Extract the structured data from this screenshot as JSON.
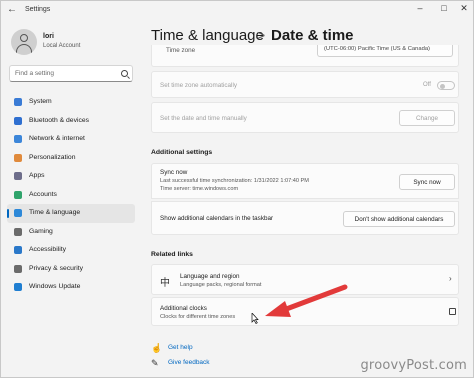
{
  "window": {
    "title": "Settings"
  },
  "user": {
    "name": "lori",
    "account_type": "Local Account"
  },
  "search": {
    "placeholder": "Find a setting"
  },
  "nav": [
    {
      "label": "System",
      "icon": "system-icon",
      "color": "#3a7bd5"
    },
    {
      "label": "Bluetooth & devices",
      "icon": "bluetooth-icon",
      "color": "#2f6fd0"
    },
    {
      "label": "Network & internet",
      "icon": "network-icon",
      "color": "#3c86d9"
    },
    {
      "label": "Personalization",
      "icon": "brush-icon",
      "color": "#e08a3c"
    },
    {
      "label": "Apps",
      "icon": "apps-icon",
      "color": "#6d6d8a"
    },
    {
      "label": "Accounts",
      "icon": "accounts-icon",
      "color": "#2fa36b"
    },
    {
      "label": "Time & language",
      "icon": "clock-globe-icon",
      "color": "#2d88d8",
      "active": true
    },
    {
      "label": "Gaming",
      "icon": "gaming-icon",
      "color": "#6b6b6b"
    },
    {
      "label": "Accessibility",
      "icon": "accessibility-icon",
      "color": "#2a78c9"
    },
    {
      "label": "Privacy & security",
      "icon": "shield-icon",
      "color": "#6b6b6b"
    },
    {
      "label": "Windows Update",
      "icon": "update-icon",
      "color": "#1f7ed1"
    }
  ],
  "header": {
    "title": "Time & language",
    "separator": ">",
    "subtitle": "Date & time"
  },
  "timezone_card": {
    "label": "Time zone",
    "value": "(UTC-06:00) Pacific Time (US & Canada)"
  },
  "auto_timezone": {
    "label": "Set time zone automatically",
    "state": "Off"
  },
  "manual_date": {
    "label": "Set the date and time manually",
    "button": "Change"
  },
  "additional_settings": {
    "title": "Additional settings",
    "sync": {
      "label": "Sync now",
      "last_sync": "Last successful time synchronization: 1/31/2022 1:07:40 PM",
      "server": "Time server: time.windows.com",
      "button": "Sync now"
    },
    "calendars": {
      "label": "Show additional calendars in the taskbar",
      "selected": "Don't show additional calendars"
    }
  },
  "related_links": {
    "title": "Related links",
    "language_region": {
      "label": "Language and region",
      "sub": "Language packs, regional format"
    },
    "additional_clocks": {
      "label": "Additional clocks",
      "sub": "Clocks for different time zones"
    }
  },
  "footer": {
    "help": "Get help",
    "feedback": "Give feedback"
  },
  "watermark": "groovyPost.com",
  "colors": {
    "accent": "#0067c0",
    "arrow": "#e23a3a"
  }
}
